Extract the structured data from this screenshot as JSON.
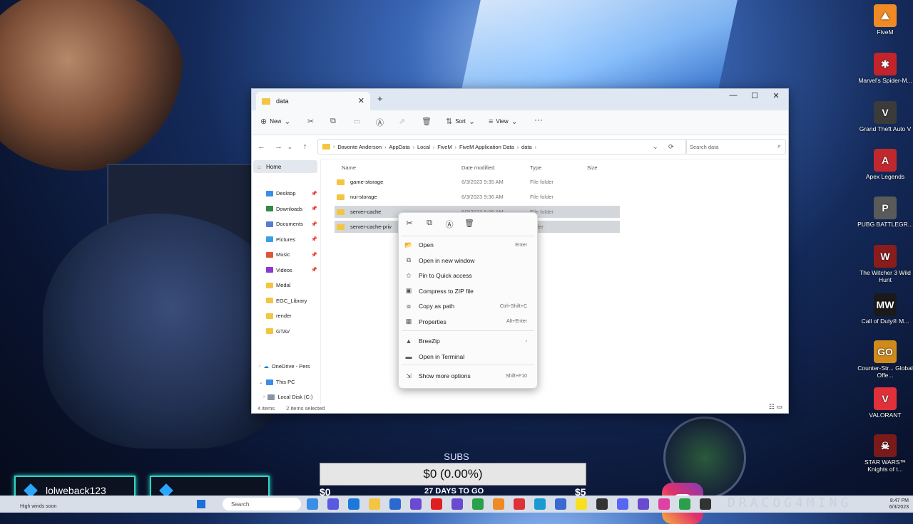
{
  "window": {
    "tab_title": "data",
    "tab_close": "✕",
    "tab_add": "+",
    "controls": {
      "minimize": "—",
      "maximize": "☐",
      "close": "✕"
    }
  },
  "toolbar": {
    "new_label": "New",
    "sort_label": "Sort",
    "view_label": "View",
    "more_label": "···"
  },
  "address": {
    "segments": [
      "Davonte Anderson",
      "AppData",
      "Local",
      "FiveM",
      "FiveM Application Data",
      "data"
    ],
    "search_placeholder": "Search data"
  },
  "nav": {
    "home": "Home",
    "items": [
      {
        "label": "Desktop",
        "color": "#3a8ee6",
        "pinned": true
      },
      {
        "label": "Downloads",
        "color": "#2f8a4a",
        "pinned": true
      },
      {
        "label": "Documents",
        "color": "#5a7bd0",
        "pinned": true
      },
      {
        "label": "Pictures",
        "color": "#3aa0e6",
        "pinned": true
      },
      {
        "label": "Music",
        "color": "#e0553a",
        "pinned": true
      },
      {
        "label": "Videos",
        "color": "#8a3ad0",
        "pinned": true
      },
      {
        "label": "Medal",
        "color": "#f3c542",
        "pinned": false
      },
      {
        "label": "EGC_Library",
        "color": "#f3c542",
        "pinned": false
      },
      {
        "label": "render",
        "color": "#f3c542",
        "pinned": false
      },
      {
        "label": "GTAV",
        "color": "#f3c542",
        "pinned": false
      }
    ],
    "onedrive": "OneDrive - Pers",
    "this_pc": "This PC",
    "local_disk": "Local Disk (C:)"
  },
  "columns": {
    "name": "Name",
    "date": "Date modified",
    "type": "Type",
    "size": "Size"
  },
  "files": [
    {
      "name": "game-storage",
      "date": "6/3/2023 9:35 AM",
      "type": "File folder",
      "selected": false
    },
    {
      "name": "nui-storage",
      "date": "6/3/2023 9:36 AM",
      "type": "File folder",
      "selected": false
    },
    {
      "name": "server-cache",
      "date": "6/3/2023 5:06 AM",
      "type": "File folder",
      "selected": true
    },
    {
      "name": "server-cache-priv",
      "date": "",
      "type": "folder",
      "selected": true
    }
  ],
  "status": {
    "items": "4 items",
    "selected": "2 items selected"
  },
  "context_menu": {
    "items": [
      {
        "label": "Open",
        "shortcut": "Enter"
      },
      {
        "label": "Open in new window",
        "shortcut": ""
      },
      {
        "label": "Pin to Quick access",
        "shortcut": ""
      },
      {
        "label": "Compress to ZIP file",
        "shortcut": ""
      },
      {
        "label": "Copy as path",
        "shortcut": "Ctrl+Shift+C"
      },
      {
        "label": "Properties",
        "shortcut": "Alt+Enter"
      },
      {
        "label": "BreeZip",
        "shortcut": "›"
      },
      {
        "label": "Open in Terminal",
        "shortcut": ""
      },
      {
        "label": "Show more options",
        "shortcut": "Shift+F10"
      }
    ]
  },
  "desktop_icons": [
    {
      "label": "FiveM",
      "color": "#f08a24",
      "glyph": "⛰"
    },
    {
      "label": "Marvel's Spider-M...",
      "color": "#c2242a",
      "glyph": "✱"
    },
    {
      "label": "Grand Theft Auto V",
      "color": "#3b3b3b",
      "glyph": "V"
    },
    {
      "label": "Apex Legends",
      "color": "#c0282d",
      "glyph": "A"
    },
    {
      "label": "PUBG BATTLEGR...",
      "color": "#5a5a5a",
      "glyph": "P"
    },
    {
      "label": "The Witcher 3 Wild Hunt",
      "color": "#8a1c1c",
      "glyph": "W"
    },
    {
      "label": "Call of Duty® M...",
      "color": "#1a1a1a",
      "glyph": "MW"
    },
    {
      "label": "Counter-Str... Global Offe...",
      "color": "#d08a1c",
      "glyph": "GO"
    },
    {
      "label": "VALORANT",
      "color": "#e0303a",
      "glyph": "V"
    },
    {
      "label": "STAR WARS™ Knights of t...",
      "color": "#7a1a1a",
      "glyph": "☠"
    }
  ],
  "overlay": {
    "subs_label": "SUBS",
    "subs_value": "$0 (0.00%)",
    "subs_min": "$0",
    "subs_days": "27 DAYS TO GO",
    "subs_max": "$5",
    "donor1": "lolweback123",
    "donor2": "",
    "brand": "DRACOG4MING"
  },
  "taskbar": {
    "weather": "High winds soon",
    "search": "Search",
    "tray_time": "8:47 PM",
    "tray_date": "6/3/2023"
  }
}
